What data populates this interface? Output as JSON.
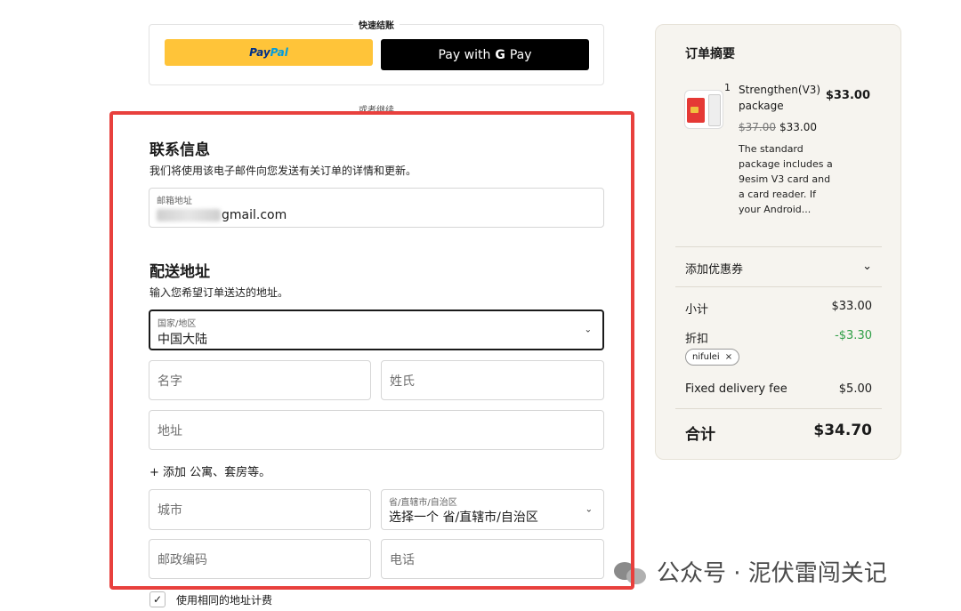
{
  "express_checkout": {
    "title": "快速结账",
    "paypal": {
      "pay": "Pay",
      "pal": "Pal"
    },
    "gpay": {
      "prefix": "Pay with",
      "g": "G",
      "suffix": "Pay"
    },
    "or_continue": "或者继续"
  },
  "contact": {
    "title": "联系信息",
    "subtitle": "我们将使用该电子邮件向您发送有关订单的详情和更新。",
    "email_label": "邮箱地址",
    "email_value": "gmail.com"
  },
  "shipping": {
    "title": "配送地址",
    "subtitle": "输入您希望订单送达的地址。",
    "country_label": "国家/地区",
    "country_value": "中国大陆",
    "first_name_placeholder": "名字",
    "last_name_placeholder": "姓氏",
    "address_placeholder": "地址",
    "add_apartment": "+ 添加 公寓、套房等。",
    "city_placeholder": "城市",
    "province_label": "省/直辖市/自治区",
    "province_value": "选择一个 省/直辖市/自治区",
    "postal_placeholder": "邮政编码",
    "phone_placeholder": "电话",
    "billing_same": "使用相同的地址计费"
  },
  "summary": {
    "title": "订单摘要",
    "product": {
      "qty": "1",
      "name": "Strengthen(V3) package",
      "price": "$33.00",
      "old_price": "$37.00",
      "new_price": "$33.00",
      "description": "The standard package includes a 9esim V3 card and a card reader. If your Android..."
    },
    "coupon_label": "添加优惠券",
    "subtotal_label": "小计",
    "subtotal_value": "$33.00",
    "discount_label": "折扣",
    "discount_value": "-$3.30",
    "discount_code": "nifulei",
    "delivery_label": "Fixed delivery fee",
    "delivery_value": "$5.00",
    "total_label": "合计",
    "total_value": "$34.70"
  },
  "watermark": "公众号 · 泥伏雷闯关记",
  "icons": {
    "chevron": "chevron-down-icon",
    "check": "check-icon",
    "remove": "close-icon"
  },
  "colors": {
    "paypal_yellow": "#ffc439",
    "highlight_red": "#e8403d",
    "discount_green": "#2e9e46",
    "summary_bg": "#f6f4ef"
  }
}
